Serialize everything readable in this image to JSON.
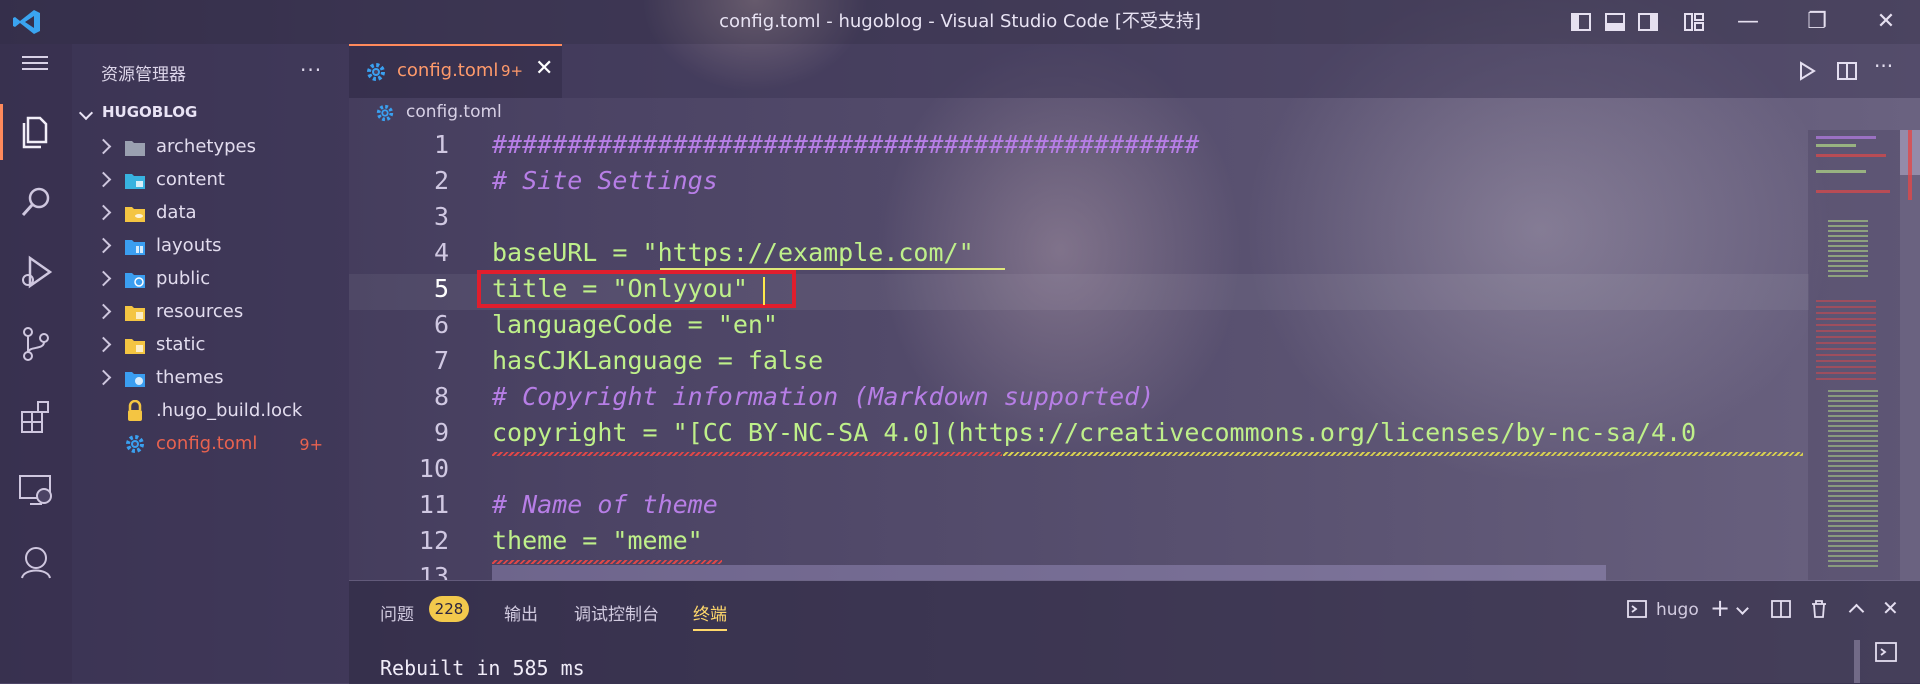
{
  "window": {
    "title": "config.toml - hugoblog - Visual Studio Code [不受支持]"
  },
  "sidebar": {
    "title": "资源管理器",
    "more": "···",
    "root": "HUGOBLOG",
    "items": [
      {
        "label": "archetypes",
        "icon": "folder-icon",
        "color": "#9aa0b0"
      },
      {
        "label": "content",
        "icon": "folder-content-icon",
        "color": "#38b3e0"
      },
      {
        "label": "data",
        "icon": "folder-data-icon",
        "color": "#f4c542"
      },
      {
        "label": "layouts",
        "icon": "folder-layouts-icon",
        "color": "#3b9ef0"
      },
      {
        "label": "public",
        "icon": "folder-public-icon",
        "color": "#3b9ef0"
      },
      {
        "label": "resources",
        "icon": "folder-resources-icon",
        "color": "#f4c542"
      },
      {
        "label": "static",
        "icon": "folder-static-icon",
        "color": "#f4c542"
      },
      {
        "label": "themes",
        "icon": "folder-themes-icon",
        "color": "#3b9ef0"
      },
      {
        "label": ".hugo_build.lock",
        "icon": "lock-icon",
        "color": "#f4c542"
      },
      {
        "label": "config.toml",
        "icon": "gear-icon",
        "color": "#3aa0f0",
        "badge": "9+"
      }
    ]
  },
  "tab": {
    "label": "config.toml",
    "count": "9+",
    "close": "✕"
  },
  "breadcrumb": "config.toml",
  "code": {
    "lines": [
      {
        "n": "1",
        "text": "###############################################",
        "kind": "comment"
      },
      {
        "n": "2",
        "text": "# Site Settings",
        "kind": "comment"
      },
      {
        "n": "3",
        "text": "",
        "kind": "plain"
      },
      {
        "n": "4",
        "text": "baseURL = \"https://example.com/\"",
        "kind": "kv"
      },
      {
        "n": "5",
        "text": "title = \"Onlyyou\"",
        "kind": "kv"
      },
      {
        "n": "6",
        "text": "languageCode = \"en\"",
        "kind": "kv"
      },
      {
        "n": "7",
        "text": "hasCJKLanguage = false",
        "kind": "kv"
      },
      {
        "n": "8",
        "text": "# Copyright information (Markdown supported)",
        "kind": "comment"
      },
      {
        "n": "9",
        "text": "copyright = \"[CC BY-NC-SA 4.0](https://creativecommons.org/licenses/by-nc-sa/4.0",
        "kind": "kv"
      },
      {
        "n": "10",
        "text": "",
        "kind": "plain"
      },
      {
        "n": "11",
        "text": "# Name of theme",
        "kind": "comment"
      },
      {
        "n": "12",
        "text": "theme = \"meme\"",
        "kind": "kv"
      },
      {
        "n": "13",
        "text": "",
        "kind": "plain"
      }
    ]
  },
  "panel": {
    "tabs": [
      {
        "label": "问题"
      },
      {
        "label": "输出"
      },
      {
        "label": "调试控制台"
      },
      {
        "label": "终端",
        "active": true
      }
    ],
    "problems_count": "228",
    "terminal_name": "hugo",
    "output": "Rebuilt in 585 ms"
  },
  "colors": {
    "accent": "#ff8a5c",
    "highlight_box": "#e01e2d",
    "badge": "#f2c94c"
  }
}
